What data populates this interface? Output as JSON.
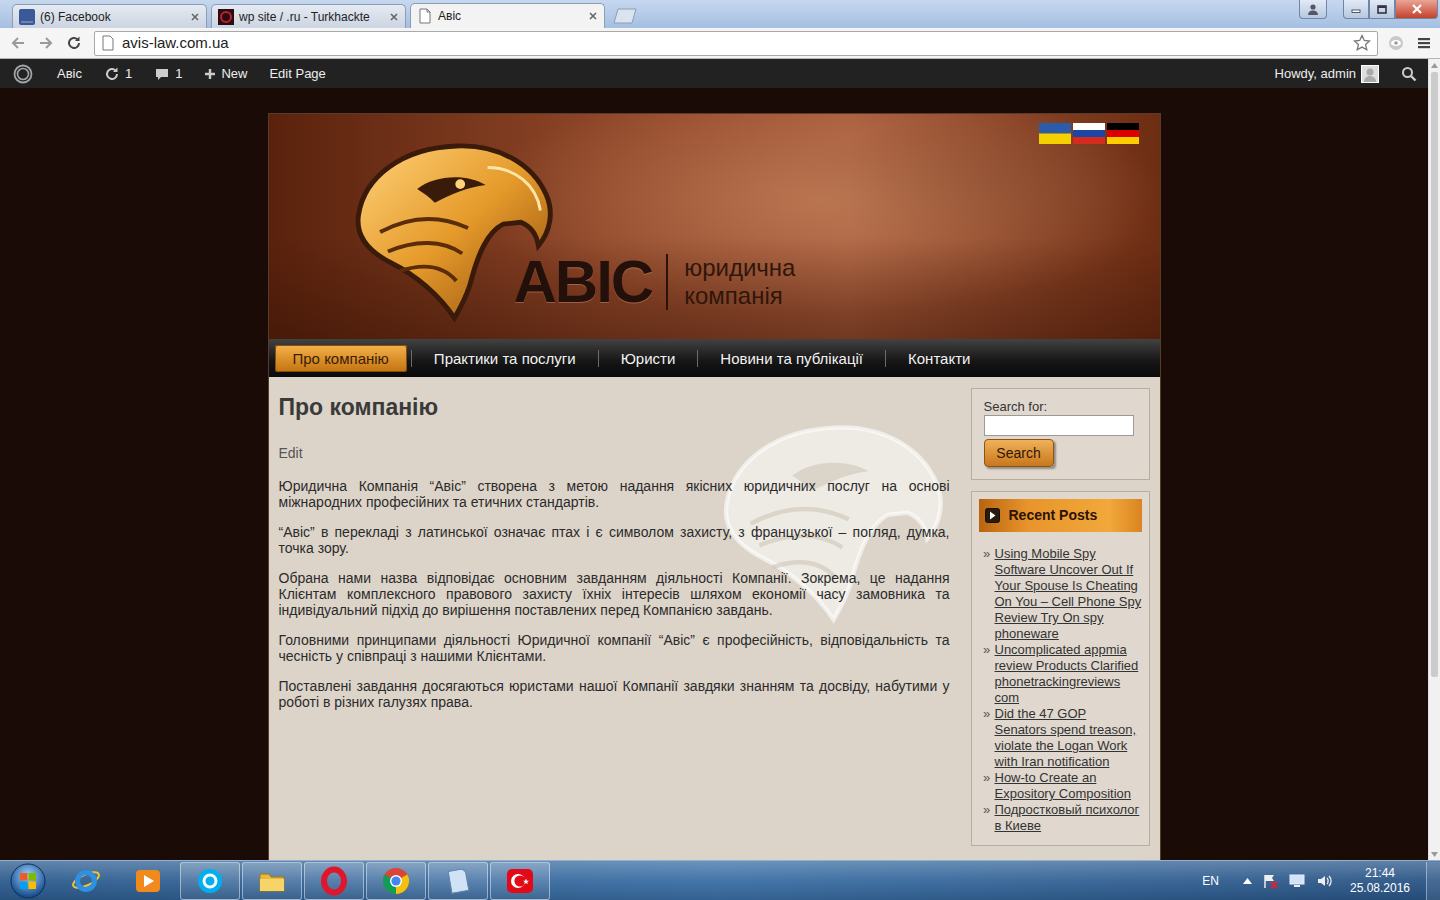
{
  "browser": {
    "tabs": [
      {
        "label": "(6) Facebook",
        "kind": "facebook",
        "selected": false
      },
      {
        "label": "wp site / .ru - Turkhackte",
        "kind": "turkhack",
        "selected": false
      },
      {
        "label": "Авіс",
        "kind": "page",
        "selected": true
      }
    ],
    "address": "avis-law.com.ua"
  },
  "admin_bar": {
    "site": "Авіс",
    "updates": "1",
    "comments": "1",
    "new": "New",
    "edit": "Edit Page",
    "greeting": "Howdy, admin"
  },
  "site": {
    "brand": {
      "name": "АВІС",
      "tagline": [
        "юридична",
        "компанія"
      ]
    },
    "nav": [
      {
        "label": "Про компанію",
        "selected": true
      },
      {
        "label": "Практики та послуги",
        "selected": false
      },
      {
        "label": "Юристи",
        "selected": false
      },
      {
        "label": "Новини та публікації",
        "selected": false
      },
      {
        "label": "Контакти",
        "selected": false
      }
    ],
    "page": {
      "title": "Про компанію",
      "edit": "Edit",
      "paragraphs": [
        "Юридична Компанія “Авіс” створена з метою надання якісних юридичних послуг на основі міжнародних професійних та етичних стандартів.",
        "“Авіс” в перекладі з латинської означає птах і є символом захисту, з французької – погляд, думка, точка зору.",
        "Обрана нами назва відповідає основним завданням діяльності Компанії. Зокрема, це надання Клієнтам комплексного правового захисту їхніх інтересів шляхом економії часу замовника та індивідуальний підхід до вирішення поставлених перед Компанією завдань.",
        "Головними принципами діяльності Юридичної компанії “Авіс” є професійність, відповідальність та чесність у співпраці з нашими Клієнтами.",
        "Поставлені завдання досягаються юристами нашої Компанії завдяки знанням та досвіду, набутими у роботі в різних галузях права."
      ]
    },
    "sidebar": {
      "search": {
        "label": "Search for:",
        "button": "Search"
      },
      "recent": {
        "title": "Recent Posts",
        "bullet": "»",
        "posts": [
          "Using Mobile Spy Software Uncover Out If Your Spouse Is Cheating On You – Cell Phone Spy Review Try On spy phoneware",
          "Uncomplicated appmia review Products Clarified phonetrackingreviews com",
          "Did the 47 GOP Senators spend treason, violate the Logan Work with Iran notification",
          "How-to Create an Expository Composition",
          "Подростковый психолог в Киеве"
        ]
      }
    }
  },
  "scrollbar": {
    "level": 0.78
  },
  "taskbar": {
    "apps": [
      {
        "kind": "ie",
        "running": false
      },
      {
        "kind": "media",
        "running": false
      },
      {
        "kind": "skype",
        "running": true
      },
      {
        "kind": "folder",
        "running": true
      },
      {
        "kind": "opera",
        "running": true
      },
      {
        "kind": "chrome",
        "running": true
      },
      {
        "kind": "notepad",
        "running": true
      },
      {
        "kind": "turkflag",
        "running": true
      }
    ],
    "language": "EN",
    "time": "21:44",
    "date": "25.08.2016"
  }
}
